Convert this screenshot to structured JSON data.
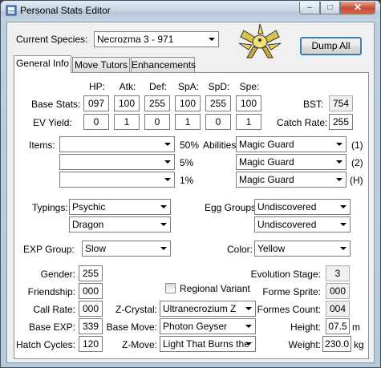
{
  "window": {
    "title": "Personal Stats Editor"
  },
  "header": {
    "species_label": "Current Species:",
    "species_value": "Necrozma 3 - 971",
    "dump_all_label": "Dump All"
  },
  "tabs": [
    {
      "label": "General Info"
    },
    {
      "label": "Move Tutors"
    },
    {
      "label": "Enhancements"
    }
  ],
  "stats": {
    "headers": [
      "HP:",
      "Atk:",
      "Def:",
      "SpA:",
      "SpD:",
      "Spe:"
    ],
    "base_label": "Base Stats:",
    "base_values": [
      "097",
      "100",
      "255",
      "100",
      "255",
      "100"
    ],
    "ev_label": "EV Yield:",
    "ev_values": [
      "0",
      "1",
      "0",
      "1",
      "0",
      "1"
    ],
    "bst_label": "BST:",
    "bst_value": "754",
    "catch_rate_label": "Catch Rate:",
    "catch_rate_value": "255"
  },
  "items": {
    "label": "Items:",
    "slots": [
      {
        "value": "",
        "chance": "50%"
      },
      {
        "value": "",
        "chance": "5%"
      },
      {
        "value": "",
        "chance": "1%"
      }
    ]
  },
  "abilities": {
    "label": "Abilities:",
    "slots": [
      {
        "value": "Magic Guard",
        "tag": "(1)"
      },
      {
        "value": "Magic Guard",
        "tag": "(2)"
      },
      {
        "value": "Magic Guard",
        "tag": "(H)"
      }
    ]
  },
  "typings": {
    "label": "Typings:",
    "type1": "Psychic",
    "type2": "Dragon"
  },
  "egg_groups": {
    "label": "Egg Groups:",
    "group1": "Undiscovered",
    "group2": "Undiscovered"
  },
  "exp_group": {
    "label": "EXP Group:",
    "value": "Slow"
  },
  "color": {
    "label": "Color:",
    "value": "Yellow"
  },
  "misc": {
    "gender_label": "Gender:",
    "gender_value": "255",
    "friendship_label": "Friendship:",
    "friendship_value": "000",
    "call_rate_label": "Call Rate:",
    "call_rate_value": "000",
    "base_exp_label": "Base EXP:",
    "base_exp_value": "339",
    "hatch_cycles_label": "Hatch Cycles:",
    "hatch_cycles_value": "120",
    "regional_variant_label": "Regional Variant",
    "z_crystal_label": "Z-Crystal:",
    "z_crystal_value": "Ultranecrozium Z",
    "base_move_label": "Base Move:",
    "base_move_value": "Photon Geyser",
    "z_move_label": "Z-Move:",
    "z_move_value": "Light That Burns the",
    "evolution_stage_label": "Evolution Stage:",
    "evolution_stage_value": "3",
    "forme_sprite_label": "Forme Sprite:",
    "forme_sprite_value": "000",
    "formes_count_label": "Formes Count:",
    "formes_count_value": "004",
    "height_label": "Height:",
    "height_value": "07.5",
    "height_unit": "m",
    "weight_label": "Weight:",
    "weight_value": "230.0",
    "weight_unit": "kg"
  }
}
